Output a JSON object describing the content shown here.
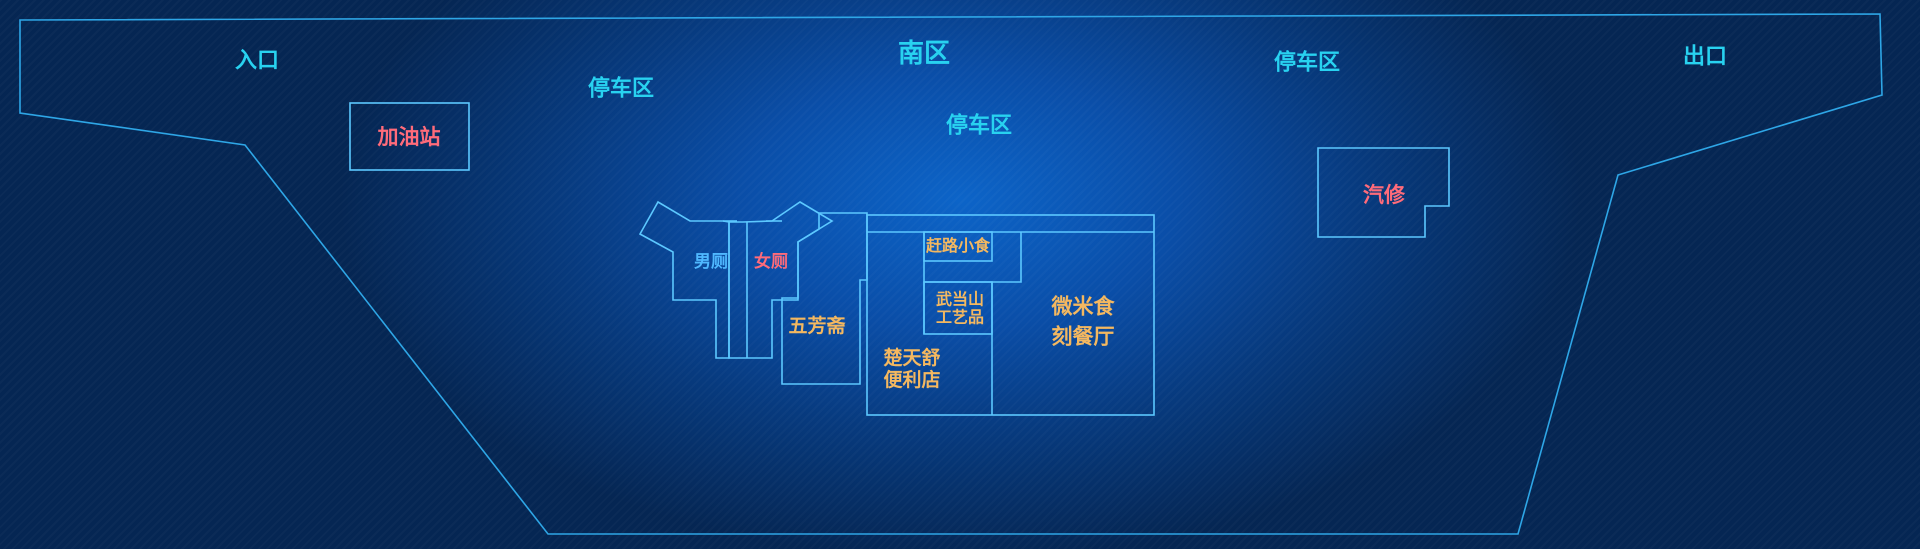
{
  "map": {
    "zones": {
      "entrance": "入口",
      "exit": "出口",
      "south_area": "南区",
      "parking_left": "停车区",
      "parking_center": "停车区",
      "parking_right": "停车区"
    },
    "services": {
      "gas_station": "加油站",
      "auto_repair": "汽修"
    },
    "restrooms": {
      "men": "男厕",
      "women": "女厕"
    },
    "shops": {
      "wufangzhai": "五芳斋",
      "quick_snack": "赶路小食",
      "wudang_crafts_line1": "武当山",
      "wudang_crafts_line2": "工艺品",
      "convenience_line1": "楚天舒",
      "convenience_line2": "便利店",
      "restaurant_line1": "微米食",
      "restaurant_line2": "刻餐厅"
    },
    "colors": {
      "zone_label": "#28d2f0",
      "shop_label": "#f4b860",
      "service_label": "#ff6b7a",
      "men_label": "#4fb8ff",
      "outline": "#2ea6e6",
      "background": "#0a4ea8"
    }
  }
}
